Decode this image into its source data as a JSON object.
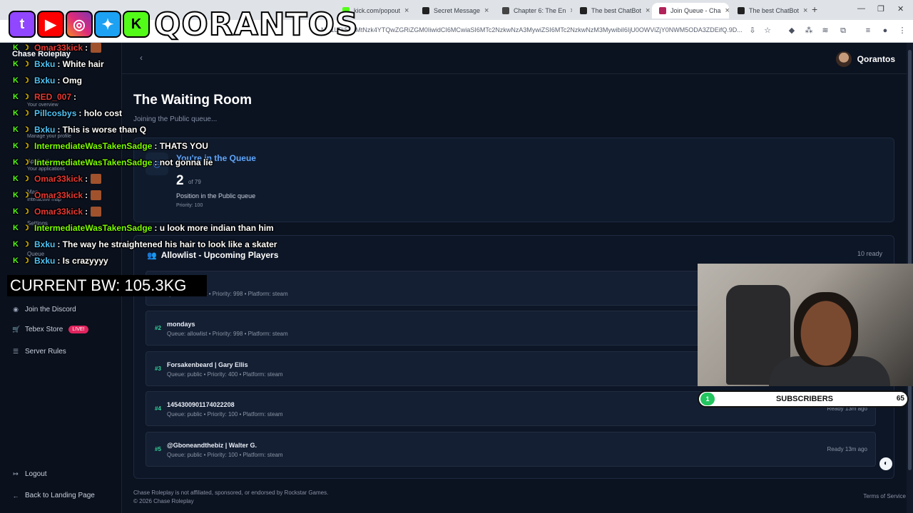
{
  "browser": {
    "tabs": [
      {
        "label": "kick.com/popout",
        "color": "#53fc18",
        "active": false
      },
      {
        "label": "Secret Message",
        "color": "#222",
        "active": false
      },
      {
        "label": "Chapter 6: The En",
        "color": "#444",
        "active": false
      },
      {
        "label": "The best ChatBot",
        "color": "#222",
        "active": false
      },
      {
        "label": "Join Queue - Cha",
        "color": "#b1235a",
        "active": true
      },
      {
        "label": "The best ChatBot",
        "color": "#222",
        "active": false
      }
    ],
    "url": "NzI1LTk5YzMtNzk4YTQwZGRiZGM0IiwidCI6MCwiaSI6MTc2NzkwNzA3MywiZSI6MTc2NzkwNzM3MywibiI6IjU0OWViZjY0NWM5ODA3ZDEifQ.9D..."
  },
  "sidebar": {
    "items": [
      {
        "label": "Your overview"
      },
      {
        "label": "Manage your profile"
      },
      {
        "label": "Applications"
      },
      {
        "label": "Your applications"
      },
      {
        "label": "Map"
      },
      {
        "label": "Interactive map"
      },
      {
        "label": "Settings"
      },
      {
        "label": "Queue"
      }
    ],
    "discord": "Join the Discord",
    "tebex": "Tebex Store",
    "live": "LIVE!",
    "rules": "Server Rules",
    "logout": "Logout",
    "back": "Back to Landing Page"
  },
  "header": {
    "username": "Qorantos"
  },
  "main": {
    "title": "The Waiting Room",
    "subtitle": "Joining the Public queue...",
    "queue": {
      "heading": "You're in the Queue",
      "position": "2",
      "of_total": "of 79",
      "label": "Position in the Public queue",
      "priority": "Priority: 100"
    },
    "allowlist": {
      "title": "Allowlist - Upcoming Players",
      "count": "10 ready",
      "rows": [
        {
          "num": "#1",
          "name": "",
          "meta": "Queue: allowlist • Priority: 998 • Platform: steam",
          "status": ""
        },
        {
          "num": "#2",
          "name": "mondays",
          "meta": "Queue: allowlist • Priority: 998 • Platform: steam",
          "status": ""
        },
        {
          "num": "#3",
          "name": "Forsakenbeard | Gary Ellis",
          "meta": "Queue: public • Priority: 400 • Platform: steam",
          "status": ""
        },
        {
          "num": "#4",
          "name": "1454300901174022208",
          "meta": "Queue: public • Priority: 100 • Platform: steam",
          "status": "Ready 13m ago"
        },
        {
          "num": "#5",
          "name": "@Gboneandthebiz | Walter G.",
          "meta": "Queue: public • Priority: 100 • Platform: steam",
          "status": "Ready 13m ago"
        }
      ]
    }
  },
  "footer": {
    "line1": "Chase Roleplay is not affiliated, sponsored, or endorsed by Rockstar Games.",
    "line2": "© 2026 Chase Roleplay",
    "terms": "Terms of Service"
  },
  "overlay": {
    "brand": "QORANTOS",
    "chat": [
      {
        "user": "Omar33kick",
        "color": "#e53935",
        "msg": ":",
        "emote": true
      },
      {
        "user": "Bxku",
        "color": "#4fc3f7",
        "msg": ": White hair",
        "emote": false
      },
      {
        "user": "Bxku",
        "color": "#4fc3f7",
        "msg": ": Omg",
        "emote": false
      },
      {
        "user": "RED_007",
        "color": "#e53935",
        "msg": ":",
        "emote": false
      },
      {
        "user": "Pillcosbys",
        "color": "#4fc3f7",
        "msg": ": holo cost",
        "emote": false
      },
      {
        "user": "Bxku",
        "color": "#4fc3f7",
        "msg": ": This is worse than Q",
        "emote": false
      },
      {
        "user": "IntermediateWasTakenSadge",
        "color": "#7cfc00",
        "msg": ": THATS YOU",
        "emote": false
      },
      {
        "user": "IntermediateWasTakenSadge",
        "color": "#7cfc00",
        "msg": ": not gonna lie",
        "emote": false
      },
      {
        "user": "Omar33kick",
        "color": "#e53935",
        "msg": ":",
        "emote": true
      },
      {
        "user": "Omar33kick",
        "color": "#e53935",
        "msg": ":",
        "emote": true
      },
      {
        "user": "Omar33kick",
        "color": "#e53935",
        "msg": ":",
        "emote": true
      },
      {
        "user": "IntermediateWasTakenSadge",
        "color": "#7cfc00",
        "msg": ": u look more indian than him",
        "emote": false
      },
      {
        "user": "Bxku",
        "color": "#4fc3f7",
        "msg": ": The way he straightened his hair to look like a skater",
        "emote": false
      },
      {
        "user": "Bxku",
        "color": "#4fc3f7",
        "msg": ": Is crazyyyy",
        "emote": false
      }
    ],
    "bw": "CURRENT BW: 105.3KG",
    "subs_current": "1",
    "subs_label": "SUBSCRIBERS",
    "subs_goal": "65",
    "sidebar_brand": "Chase Roleplay"
  }
}
